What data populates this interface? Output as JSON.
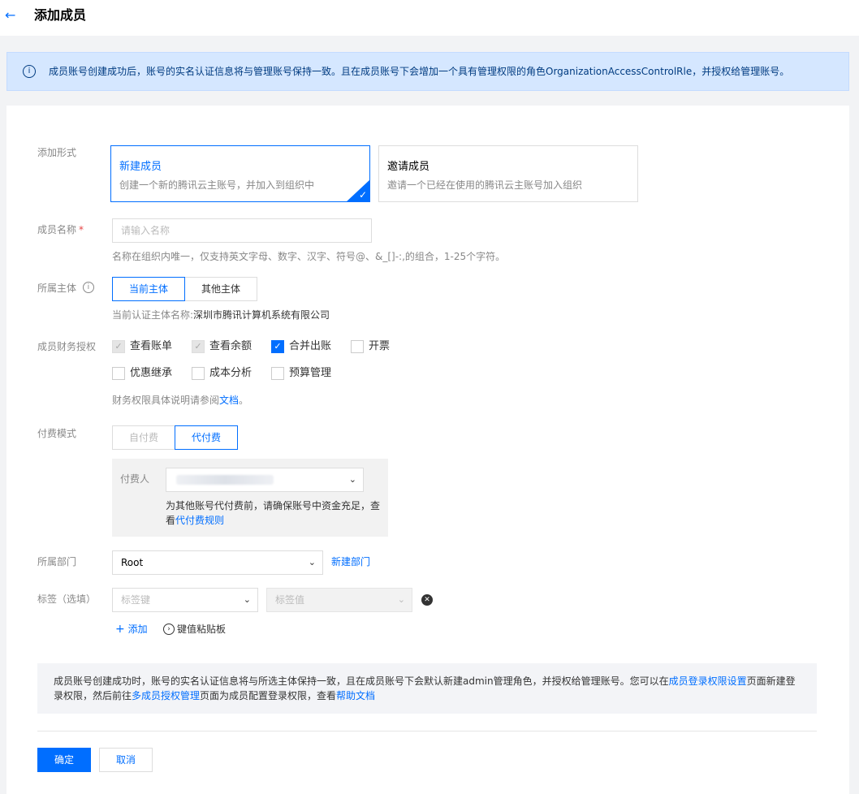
{
  "header": {
    "title": "添加成员",
    "back_icon": "arrow-left-icon"
  },
  "notice": {
    "text": "成员账号创建成功后，账号的实名认证信息将与管理账号保持一致。且在成员账号下会增加一个具有管理权限的角色OrganizationAccessControlRle，并授权给管理账号。"
  },
  "form": {
    "add_type": {
      "label": "添加形式",
      "options": [
        {
          "title": "新建成员",
          "desc": "创建一个新的腾讯云主账号，并加入到组织中",
          "selected": true
        },
        {
          "title": "邀请成员",
          "desc": "邀请一个已经在使用的腾讯云主账号加入组织",
          "selected": false
        }
      ]
    },
    "member_name": {
      "label": "成员名称",
      "required_mark": "*",
      "placeholder": "请输入名称",
      "hint": "名称在组织内唯一，仅支持英文字母、数字、汉字、符号@、&_[]-:,的组合，1-25个字符。"
    },
    "entity": {
      "label": "所属主体",
      "info_icon": "i",
      "options": [
        "当前主体",
        "其他主体"
      ],
      "selected": "当前主体",
      "hint_prefix": "当前认证主体名称:",
      "hint_value": "深圳市腾讯计算机系统有限公司"
    },
    "finance": {
      "label": "成员财务授权",
      "items": [
        {
          "label": "查看账单",
          "state": "checked-disabled"
        },
        {
          "label": "查看余额",
          "state": "checked-disabled"
        },
        {
          "label": "合并出账",
          "state": "checked"
        },
        {
          "label": "开票",
          "state": "unchecked"
        },
        {
          "label": "优惠继承",
          "state": "unchecked"
        },
        {
          "label": "成本分析",
          "state": "unchecked"
        },
        {
          "label": "预算管理",
          "state": "unchecked"
        }
      ],
      "hint_prefix": "财务权限具体说明请参阅",
      "hint_link": "文档",
      "hint_suffix": "。"
    },
    "payment": {
      "label": "付费模式",
      "options": [
        "自付费",
        "代付费"
      ],
      "selected": "代付费",
      "payer_label": "付费人",
      "payer_note_line1": "为其他账号代付费前，请确保账号中资金充足，查",
      "payer_note_line2_prefix": "看",
      "payer_note_link": "代付费规则"
    },
    "department": {
      "label": "所属部门",
      "value": "Root",
      "new_link": "新建部门"
    },
    "tags": {
      "label": "标签（选填）",
      "key_placeholder": "标签键",
      "value_placeholder": "标签值",
      "add_label": "添加",
      "paste_label": "键值粘贴板"
    },
    "tip": {
      "part1": "成员账号创建成功时，账号的实名认证信息将与所选主体保持一致，且在成员账号下会默认新建admin管理角色，并授权给管理账号。您可以在",
      "link1": "成员登录权限设置",
      "part2": "页面新建登录权限，然后前往",
      "link2": "多成员授权管理",
      "part3": "页面为成员配置登录权限，查看",
      "link3": "帮助文档"
    },
    "actions": {
      "confirm": "确定",
      "cancel": "取消"
    }
  },
  "colors": {
    "accent": "#006eff",
    "notice_bg": "#d5e7ff",
    "notice_text": "#003b80",
    "required": "#e54545"
  }
}
